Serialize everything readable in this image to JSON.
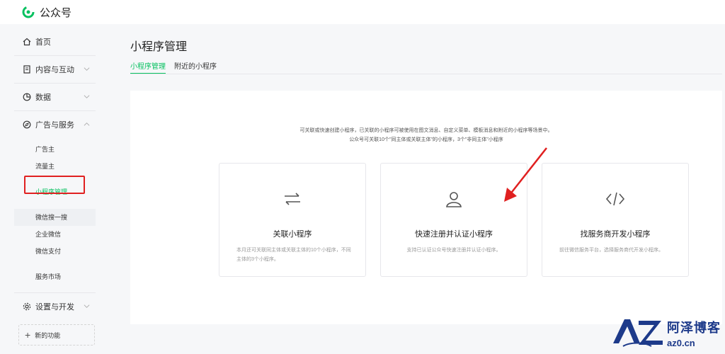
{
  "app": {
    "title": "公众号"
  },
  "sidebar": {
    "home": "首页",
    "content": "内容与互动",
    "data": "数据",
    "ads": "广告与服务",
    "ads_sub": [
      "广告主",
      "流量主",
      "小程序管理",
      "微信搜一搜",
      "企业微信",
      "微信支付",
      "服务市场"
    ],
    "settings": "设置与开发",
    "new_func": "新的功能"
  },
  "main": {
    "title": "小程序管理",
    "tabs": [
      "小程序管理",
      "附近的小程序"
    ],
    "desc_line1": "可关联或快速创建小程序，已关联的小程序可被使用在图文消息、自定义菜单、模板消息和附近的小程序等场景中。",
    "desc_line2": "公众号可关联10个\"同主体或关联主体\"的小程序，3个\"非同主体\"小程序",
    "options": [
      {
        "title": "关联小程序",
        "desc": "本月还可关联同主体或关联主体的10个小程序，不同主体的3个小程序。",
        "icon": "swap-arrows-icon"
      },
      {
        "title": "快速注册并认证小程序",
        "desc": "支持已认证公众号快速注册并认证小程序。",
        "icon": "user-outline-icon"
      },
      {
        "title": "找服务商开发小程序",
        "desc": "前往微信服务平台，选择服务商代开发小程序。",
        "icon": "code-icon"
      }
    ]
  },
  "watermark": {
    "text": "阿泽博客",
    "url": "az0.cn",
    "logo": "AZ"
  },
  "colors": {
    "accent": "#07c160",
    "highlight": "#e02020",
    "watermark": "#1d3a8a"
  }
}
